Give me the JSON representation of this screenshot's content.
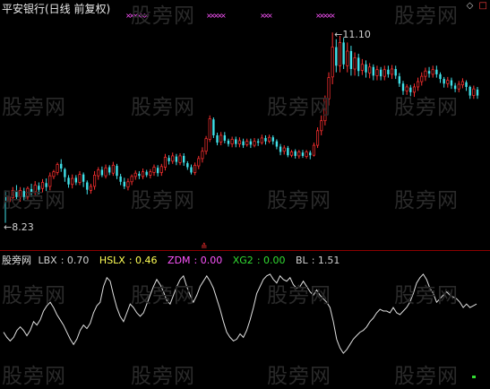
{
  "title": "平安银行(日线 前复权)",
  "corner_icons": [
    {
      "name": "diamond-icon",
      "glyph": "◇",
      "color": "#c8c8c8"
    },
    {
      "name": "square-icon",
      "glyph": "□",
      "color": "#ff4040"
    }
  ],
  "watermark": "股旁网",
  "indicator": {
    "name": "股旁网",
    "items": [
      {
        "key": "LBX",
        "value": "0.70",
        "color": "#d0d0d0"
      },
      {
        "key": "HSLX",
        "value": "0.46",
        "color": "#ffff55"
      },
      {
        "key": "ZDM",
        "value": "0.00",
        "color": "#ff55ff"
      },
      {
        "key": "XG2",
        "value": "0.00",
        "color": "#33dd33"
      },
      {
        "key": "BL",
        "value": "1.51",
        "color": "#d0d0d0"
      }
    ]
  },
  "colors": {
    "up": "#ff3030",
    "down": "#40e0e8",
    "marker": "#ff55ff",
    "line": "#e0e0e0",
    "divider": "#8b0000"
  },
  "chart_data": {
    "type": "candlestick",
    "annotations": [
      {
        "text": "11.10",
        "kind": "high",
        "value": 11.1
      },
      {
        "text": "8.23",
        "kind": "low",
        "value": 8.23
      }
    ],
    "ylim": [
      8.05,
      11.32
    ],
    "candles": [
      [
        8.62,
        8.55,
        8.72,
        8.23
      ],
      [
        8.55,
        8.62,
        8.7,
        8.48
      ],
      [
        8.61,
        8.72,
        8.77,
        8.55
      ],
      [
        8.71,
        8.62,
        8.8,
        8.57
      ],
      [
        8.62,
        8.72,
        8.77,
        8.55
      ],
      [
        8.71,
        8.62,
        8.76,
        8.57
      ],
      [
        8.62,
        8.75,
        8.78,
        8.58
      ],
      [
        8.74,
        8.69,
        8.82,
        8.62
      ],
      [
        8.7,
        8.8,
        8.86,
        8.65
      ],
      [
        8.79,
        8.73,
        8.84,
        8.66
      ],
      [
        8.75,
        8.84,
        8.89,
        8.69
      ],
      [
        8.83,
        8.77,
        8.9,
        8.71
      ],
      [
        8.78,
        8.94,
        8.99,
        8.72
      ],
      [
        8.93,
        9.0,
        9.03,
        8.89
      ],
      [
        8.99,
        9.11,
        9.14,
        8.95
      ],
      [
        9.12,
        9.05,
        9.19,
        9.0
      ],
      [
        9.04,
        8.92,
        9.06,
        8.85
      ],
      [
        8.91,
        8.81,
        8.95,
        8.76
      ],
      [
        8.81,
        8.9,
        8.96,
        8.75
      ],
      [
        8.91,
        8.84,
        8.95,
        8.8
      ],
      [
        8.84,
        8.96,
        9.01,
        8.8
      ],
      [
        8.96,
        8.85,
        8.99,
        8.77
      ],
      [
        8.84,
        8.73,
        8.87,
        8.66
      ],
      [
        8.72,
        8.78,
        8.82,
        8.67
      ],
      [
        8.78,
        8.95,
        9.01,
        8.73
      ],
      [
        8.94,
        9.03,
        9.07,
        8.88
      ],
      [
        9.03,
        8.95,
        9.08,
        8.92
      ],
      [
        8.94,
        9.06,
        9.11,
        8.9
      ],
      [
        9.07,
        8.99,
        9.1,
        8.95
      ],
      [
        8.98,
        9.1,
        9.15,
        8.94
      ],
      [
        9.09,
        8.94,
        9.12,
        8.89
      ],
      [
        8.93,
        8.85,
        8.97,
        8.8
      ],
      [
        8.85,
        8.78,
        8.91,
        8.74
      ],
      [
        8.77,
        8.85,
        8.9,
        8.72
      ],
      [
        8.85,
        8.93,
        8.96,
        8.8
      ],
      [
        8.93,
        8.98,
        9.02,
        8.88
      ],
      [
        8.97,
        8.94,
        9.01,
        8.89
      ],
      [
        8.93,
        9.0,
        9.05,
        8.89
      ],
      [
        9.0,
        8.95,
        9.03,
        8.92
      ],
      [
        8.95,
        9.0,
        9.04,
        8.9
      ],
      [
        8.99,
        9.07,
        9.11,
        8.94
      ],
      [
        9.06,
        8.98,
        9.1,
        8.93
      ],
      [
        8.99,
        9.08,
        9.12,
        8.94
      ],
      [
        9.07,
        9.22,
        9.27,
        9.02
      ],
      [
        9.21,
        9.16,
        9.25,
        9.11
      ],
      [
        9.16,
        9.24,
        9.29,
        9.12
      ],
      [
        9.23,
        9.15,
        9.27,
        9.1
      ],
      [
        9.14,
        9.24,
        9.28,
        9.1
      ],
      [
        9.24,
        9.14,
        9.28,
        9.09
      ],
      [
        9.13,
        9.07,
        9.16,
        9.03
      ],
      [
        9.07,
        8.99,
        9.11,
        8.96
      ],
      [
        8.99,
        9.1,
        9.14,
        8.95
      ],
      [
        9.09,
        9.2,
        9.24,
        9.04
      ],
      [
        9.2,
        9.31,
        9.37,
        9.14
      ],
      [
        9.31,
        9.5,
        9.54,
        9.26
      ],
      [
        9.49,
        9.8,
        9.85,
        9.45
      ],
      [
        9.79,
        9.55,
        9.82,
        9.51
      ],
      [
        9.55,
        9.44,
        9.59,
        9.4
      ],
      [
        9.45,
        9.55,
        9.6,
        9.4
      ],
      [
        9.55,
        9.47,
        9.6,
        9.43
      ],
      [
        9.47,
        9.42,
        9.5,
        9.38
      ],
      [
        9.42,
        9.49,
        9.53,
        9.37
      ],
      [
        9.49,
        9.42,
        9.53,
        9.37
      ],
      [
        9.42,
        9.47,
        9.52,
        9.37
      ],
      [
        9.46,
        9.4,
        9.5,
        9.36
      ],
      [
        9.41,
        9.46,
        9.5,
        9.38
      ],
      [
        9.46,
        9.41,
        9.5,
        9.36
      ],
      [
        9.4,
        9.46,
        9.51,
        9.37
      ],
      [
        9.46,
        9.44,
        9.5,
        9.39
      ],
      [
        9.44,
        9.51,
        9.56,
        9.41
      ],
      [
        9.51,
        9.46,
        9.55,
        9.41
      ],
      [
        9.46,
        9.52,
        9.56,
        9.43
      ],
      [
        9.52,
        9.46,
        9.55,
        9.41
      ],
      [
        9.46,
        9.38,
        9.49,
        9.34
      ],
      [
        9.38,
        9.3,
        9.42,
        9.25
      ],
      [
        9.31,
        9.36,
        9.4,
        9.26
      ],
      [
        9.36,
        9.25,
        9.39,
        9.22
      ],
      [
        9.25,
        9.3,
        9.33,
        9.22
      ],
      [
        9.31,
        9.24,
        9.34,
        9.2
      ],
      [
        9.24,
        9.3,
        9.33,
        9.2
      ],
      [
        9.29,
        9.24,
        9.33,
        9.21
      ],
      [
        9.23,
        9.3,
        9.33,
        9.2
      ],
      [
        9.29,
        9.25,
        9.32,
        9.19
      ],
      [
        9.25,
        9.4,
        9.44,
        9.23
      ],
      [
        9.4,
        9.62,
        9.67,
        9.36
      ],
      [
        9.62,
        9.77,
        9.85,
        9.55
      ],
      [
        9.77,
        10.1,
        10.15,
        9.7
      ],
      [
        10.1,
        10.42,
        10.5,
        10.0
      ],
      [
        10.43,
        10.88,
        11.1,
        10.32
      ],
      [
        10.88,
        10.6,
        11.0,
        10.5
      ],
      [
        10.6,
        10.95,
        11.05,
        10.5
      ],
      [
        10.95,
        10.62,
        11.02,
        10.55
      ],
      [
        10.6,
        10.82,
        10.95,
        10.5
      ],
      [
        10.82,
        10.55,
        10.9,
        10.45
      ],
      [
        10.55,
        10.72,
        10.8,
        10.45
      ],
      [
        10.72,
        10.52,
        10.78,
        10.44
      ],
      [
        10.53,
        10.62,
        10.7,
        10.46
      ],
      [
        10.62,
        10.5,
        10.68,
        10.42
      ],
      [
        10.49,
        10.58,
        10.64,
        10.41
      ],
      [
        10.58,
        10.45,
        10.62,
        10.38
      ],
      [
        10.45,
        10.54,
        10.6,
        10.38
      ],
      [
        10.54,
        10.44,
        10.58,
        10.38
      ],
      [
        10.44,
        10.54,
        10.6,
        10.38
      ],
      [
        10.54,
        10.47,
        10.6,
        10.42
      ],
      [
        10.47,
        10.55,
        10.61,
        10.4
      ],
      [
        10.55,
        10.45,
        10.6,
        10.4
      ],
      [
        10.44,
        10.33,
        10.49,
        10.28
      ],
      [
        10.33,
        10.22,
        10.37,
        10.16
      ],
      [
        10.22,
        10.28,
        10.32,
        10.16
      ],
      [
        10.27,
        10.2,
        10.31,
        10.14
      ],
      [
        10.2,
        10.28,
        10.33,
        10.13
      ],
      [
        10.28,
        10.36,
        10.42,
        10.22
      ],
      [
        10.36,
        10.44,
        10.5,
        10.3
      ],
      [
        10.44,
        10.52,
        10.57,
        10.37
      ],
      [
        10.52,
        10.48,
        10.58,
        10.42
      ],
      [
        10.47,
        10.54,
        10.6,
        10.42
      ],
      [
        10.54,
        10.47,
        10.6,
        10.42
      ],
      [
        10.47,
        10.4,
        10.5,
        10.34
      ],
      [
        10.4,
        10.33,
        10.43,
        10.27
      ],
      [
        10.33,
        10.38,
        10.43,
        10.27
      ],
      [
        10.38,
        10.3,
        10.42,
        10.25
      ],
      [
        10.3,
        10.25,
        10.34,
        10.2
      ],
      [
        10.25,
        10.32,
        10.37,
        10.2
      ],
      [
        10.31,
        10.36,
        10.41,
        10.26
      ],
      [
        10.35,
        10.28,
        10.38,
        10.22
      ],
      [
        10.28,
        10.15,
        10.3,
        10.1
      ],
      [
        10.15,
        10.25,
        10.3,
        10.1
      ],
      [
        10.24,
        10.15,
        10.28,
        10.1
      ]
    ],
    "indicator_line": [
      0.28,
      0.22,
      0.18,
      0.22,
      0.3,
      0.34,
      0.3,
      0.24,
      0.3,
      0.4,
      0.36,
      0.42,
      0.52,
      0.58,
      0.62,
      0.56,
      0.48,
      0.42,
      0.36,
      0.28,
      0.2,
      0.14,
      0.2,
      0.3,
      0.36,
      0.32,
      0.38,
      0.5,
      0.58,
      0.62,
      0.8,
      0.9,
      0.86,
      0.7,
      0.56,
      0.46,
      0.4,
      0.5,
      0.6,
      0.56,
      0.5,
      0.46,
      0.5,
      0.6,
      0.7,
      0.8,
      0.88,
      0.82,
      0.74,
      0.64,
      0.6,
      0.7,
      0.8,
      0.88,
      0.92,
      0.8,
      0.7,
      0.62,
      0.7,
      0.8,
      0.86,
      0.92,
      0.86,
      0.78,
      0.66,
      0.54,
      0.4,
      0.28,
      0.22,
      0.18,
      0.2,
      0.26,
      0.22,
      0.3,
      0.42,
      0.56,
      0.72,
      0.8,
      0.88,
      0.92,
      0.94,
      0.88,
      0.84,
      0.92,
      0.88,
      0.86,
      0.9,
      0.82,
      0.78,
      0.8,
      0.86,
      0.8,
      0.74,
      0.7,
      0.76,
      0.7,
      0.66,
      0.62,
      0.56,
      0.4,
      0.2,
      0.1,
      0.04,
      0.08,
      0.14,
      0.2,
      0.24,
      0.28,
      0.3,
      0.34,
      0.4,
      0.44,
      0.5,
      0.54,
      0.52,
      0.52,
      0.5,
      0.56,
      0.5,
      0.48,
      0.52,
      0.56,
      0.62,
      0.72,
      0.84,
      0.9,
      0.94,
      0.88,
      0.78,
      0.72,
      0.62,
      0.66,
      0.7,
      0.74,
      0.7,
      0.68,
      0.66,
      0.62,
      0.56,
      0.6,
      0.56,
      0.58,
      0.6
    ]
  }
}
